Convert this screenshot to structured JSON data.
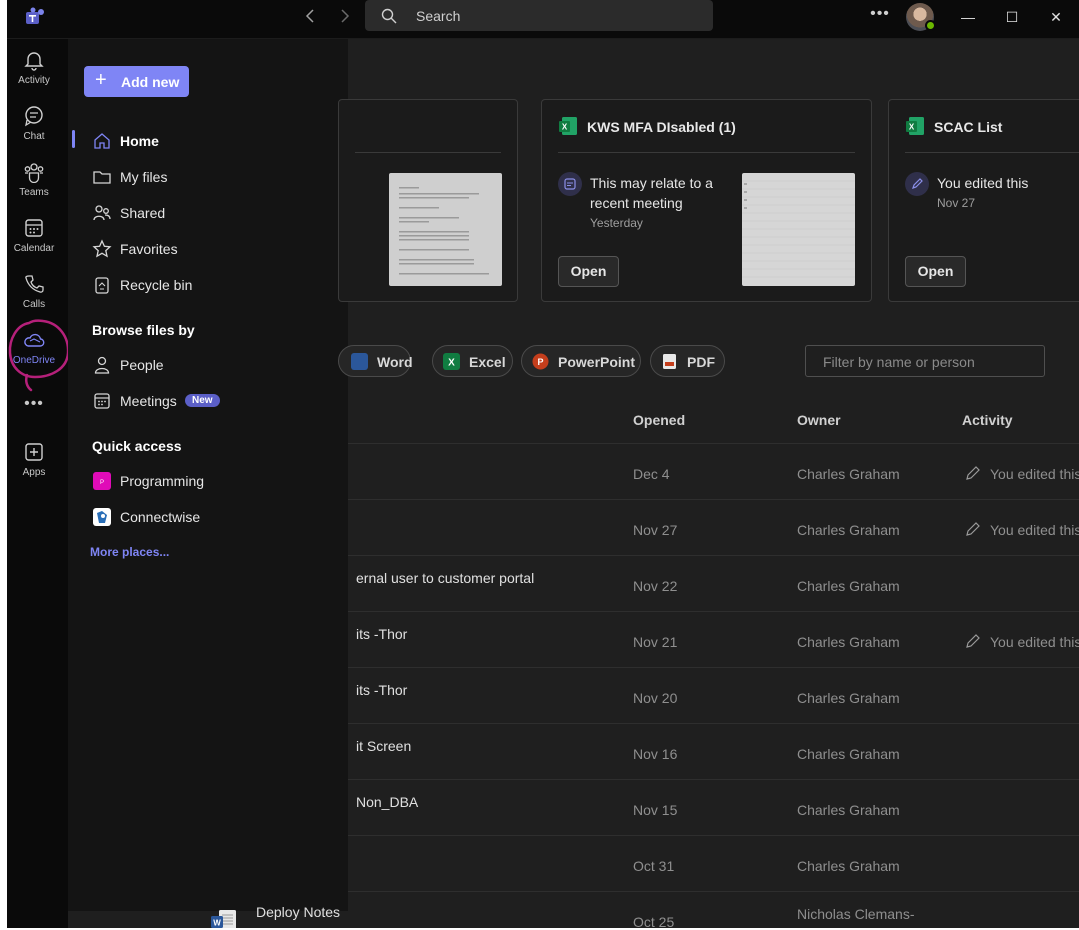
{
  "titlebar": {
    "search_placeholder": "Search",
    "more_label": "•••",
    "back_icon": "chevron-left-icon",
    "forward_icon": "chevron-right-icon",
    "minimize_label": "—",
    "maximize_label": "☐",
    "close_label": "✕"
  },
  "rail": {
    "items": [
      {
        "label": "Activity",
        "icon": "bell-icon"
      },
      {
        "label": "Chat",
        "icon": "chat-icon"
      },
      {
        "label": "Teams",
        "icon": "teams-icon"
      },
      {
        "label": "Calendar",
        "icon": "calendar-icon"
      },
      {
        "label": "Calls",
        "icon": "phone-icon"
      },
      {
        "label": "OneDrive",
        "icon": "cloud-icon"
      },
      {
        "label": "Apps",
        "icon": "plus-square-icon"
      }
    ],
    "more": "•••",
    "active_color": "#7f85f5",
    "annotation_color": "#b5207a"
  },
  "nav": {
    "add_new": "Add new",
    "home": "Home",
    "my_files": "My files",
    "shared": "Shared",
    "favorites": "Favorites",
    "recycle_bin": "Recycle bin",
    "browse_header": "Browse files by",
    "people": "People",
    "meetings": "Meetings",
    "meetings_badge": "New",
    "quick_access_header": "Quick access",
    "programming": "Programming",
    "connectwise": "Connectwise",
    "more_places": "More places..."
  },
  "cards": [
    {
      "title": "KWS MFA DIsabled (1)",
      "line1": "This may relate to a",
      "line2": "recent meeting",
      "meta": "Yesterday",
      "open": "Open"
    },
    {
      "title": "SCAC List",
      "line1": "You edited this",
      "meta": "Nov 27",
      "open": "Open"
    }
  ],
  "filters": {
    "chips": [
      "Word",
      "Excel",
      "PowerPoint",
      "PDF"
    ],
    "input_placeholder": "Filter by name or person"
  },
  "table": {
    "headers": {
      "opened": "Opened",
      "owner": "Owner",
      "activity": "Activity"
    },
    "rows": [
      {
        "name": "",
        "opened": "Dec 4",
        "owner": "Charles Graham",
        "activity": "You edited this"
      },
      {
        "name": "",
        "opened": "Nov 27",
        "owner": "Charles Graham",
        "activity": "You edited this"
      },
      {
        "name": "ernal user to customer portal",
        "opened": "Nov 22",
        "owner": "Charles Graham",
        "activity": ""
      },
      {
        "name": "its -Thor",
        "opened": "Nov 21",
        "owner": "Charles Graham",
        "activity": "You edited this"
      },
      {
        "name": "its -Thor",
        "opened": "Nov 20",
        "owner": "Charles Graham",
        "activity": ""
      },
      {
        "name": "it Screen",
        "opened": "Nov 16",
        "owner": "Charles Graham",
        "activity": ""
      },
      {
        "name": "Non_DBA",
        "opened": "Nov 15",
        "owner": "Charles Graham",
        "activity": ""
      },
      {
        "name": "",
        "opened": "Oct 31",
        "owner": "Charles Graham",
        "activity": ""
      },
      {
        "name": "Deploy Notes",
        "opened": "Oct 25",
        "owner": "Nicholas Clemans-",
        "activity": ""
      }
    ]
  }
}
